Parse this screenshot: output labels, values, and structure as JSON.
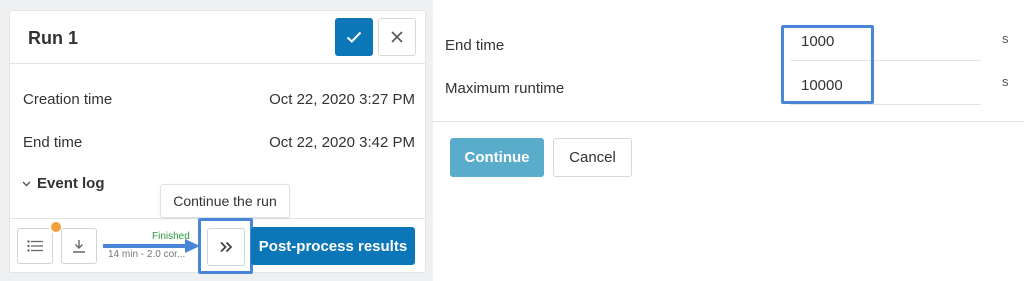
{
  "run_panel": {
    "title": "Run 1",
    "header_buttons": {
      "confirm_icon": "check-icon",
      "close_icon": "close-icon"
    },
    "details": [
      {
        "label": "Creation time",
        "value": "Oct 22, 2020 3:27 PM"
      },
      {
        "label": "End time",
        "value": "Oct 22, 2020 3:42 PM"
      }
    ],
    "event_log_label": "Event log",
    "tooltip": "Continue the run",
    "status": "Finished",
    "duration": "14 min - 2.0 cor...",
    "post_process_label": "Post-process results",
    "colors": {
      "primary": "#0b76b8",
      "badge": "#f0a23a",
      "status_green": "#2b9b3f",
      "highlight": "#4a86d8"
    }
  },
  "continue_form": {
    "fields": [
      {
        "label": "End time",
        "value": "1000",
        "unit": "s"
      },
      {
        "label": "Maximum runtime",
        "value": "10000",
        "unit": "s"
      }
    ],
    "continue_label": "Continue",
    "cancel_label": "Cancel",
    "continue_color": "#5aaccb"
  }
}
